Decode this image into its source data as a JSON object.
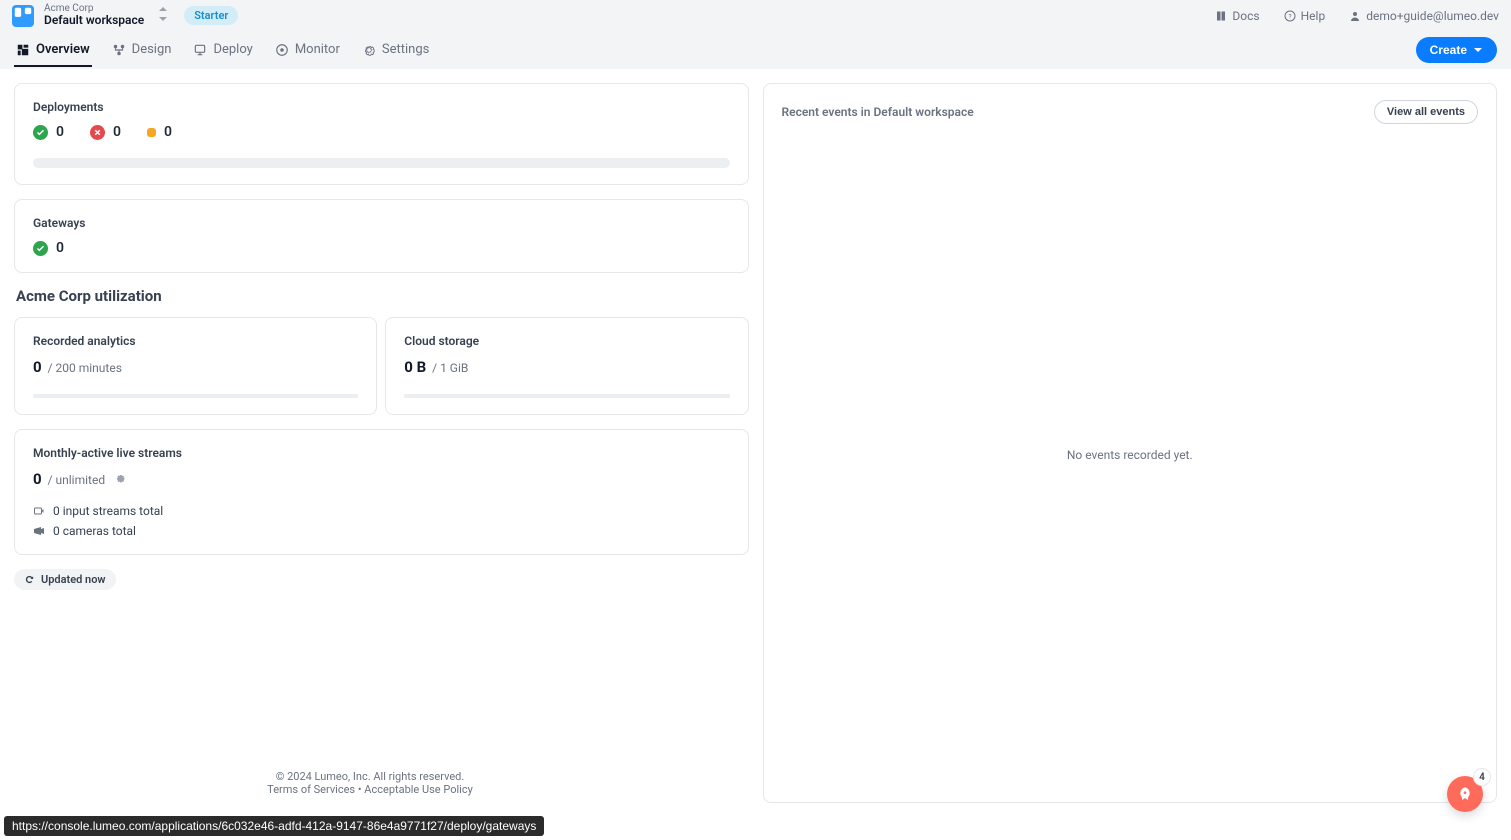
{
  "header": {
    "org": "Acme Corp",
    "workspace": "Default workspace",
    "plan_badge": "Starter",
    "links": {
      "docs": "Docs",
      "help": "Help",
      "user": "demo+guide@lumeo.dev"
    }
  },
  "tabs": {
    "overview": "Overview",
    "design": "Design",
    "deploy": "Deploy",
    "monitor": "Monitor",
    "settings": "Settings",
    "create_btn": "Create"
  },
  "deployments": {
    "title": "Deployments",
    "ok": "0",
    "err": "0",
    "warn": "0"
  },
  "gateways": {
    "title": "Gateways",
    "ok": "0"
  },
  "utilization_heading": "Acme Corp utilization",
  "recorded": {
    "title": "Recorded analytics",
    "value": "0",
    "limit": " / 200 minutes"
  },
  "storage": {
    "title": "Cloud storage",
    "value": "0 B",
    "limit": " / 1 GiB"
  },
  "streams": {
    "title": "Monthly-active live streams",
    "value": "0",
    "limit": " / unlimited",
    "input_streams": "0 input streams total",
    "cameras": "0 cameras total"
  },
  "updated_pill": "Updated now",
  "events": {
    "title": "Recent events in Default workspace",
    "view_all": "View all events",
    "empty": "No events recorded yet."
  },
  "footer": {
    "copyright": "© 2024 Lumeo, Inc. All rights reserved.",
    "terms": "Terms of Services",
    "sep": "  •  ",
    "aup": "Acceptable Use Policy"
  },
  "url_hover": "https://console.lumeo.com/applications/6c032e46-adfd-412a-9147-86e4a9771f27/deploy/gateways",
  "fab_badge": "4"
}
